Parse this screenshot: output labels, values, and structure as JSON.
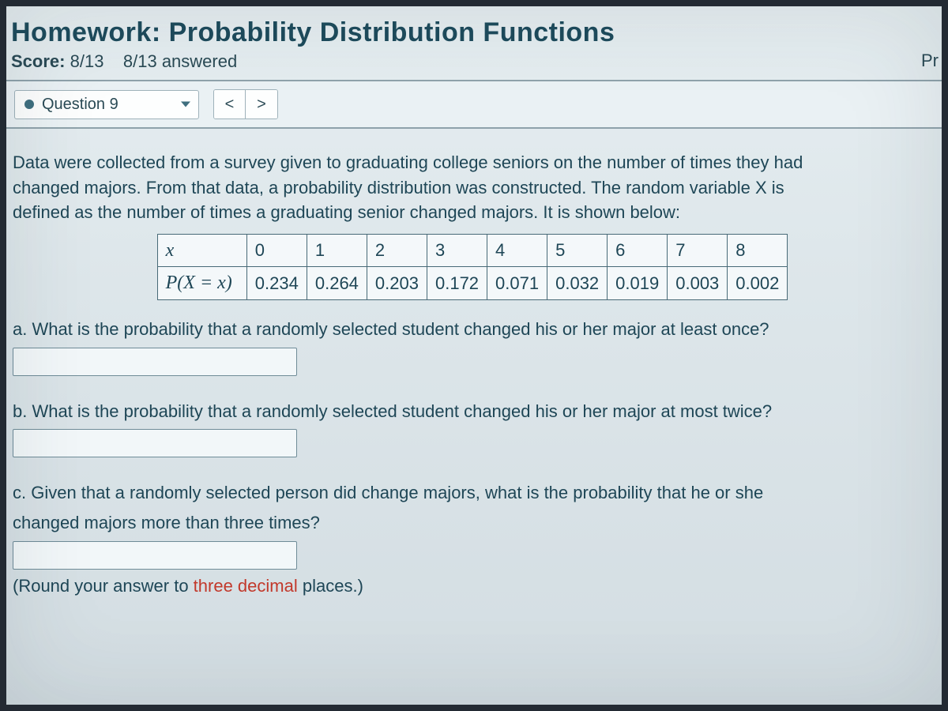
{
  "header": {
    "title": "Homework: Probability Distribution Functions",
    "score_label": "Score:",
    "score_value": "8/13",
    "answered": "8/13 answered",
    "right_badge": "Pr"
  },
  "toolbar": {
    "question_label": "Question 9",
    "prev_glyph": "<",
    "next_glyph": ">"
  },
  "prompt": {
    "line1": "Data were collected from a survey given to graduating college seniors on the number of times they had",
    "line2": "changed majors. From that data, a probability distribution was constructed. The random variable X is",
    "line3": "defined as the number of times a graduating senior changed majors. It is shown below:"
  },
  "table": {
    "row1_label": "x",
    "row2_label": "P(X = x)",
    "x": [
      "0",
      "1",
      "2",
      "3",
      "4",
      "5",
      "6",
      "7",
      "8"
    ],
    "p": [
      "0.234",
      "0.264",
      "0.203",
      "0.172",
      "0.071",
      "0.032",
      "0.019",
      "0.003",
      "0.002"
    ]
  },
  "questions": {
    "a": "a. What is the probability that a randomly selected student changed his or her major at least once?",
    "b": "b. What is the probability that a randomly selected student changed his or her major at most twice?",
    "c1": "c. Given that a randomly selected person did change majors, what is the probability that he or she",
    "c2": "changed majors more than three times?",
    "round_pre": "(Round your answer to ",
    "round_hl": "three decimal",
    "round_post": " places.)"
  }
}
